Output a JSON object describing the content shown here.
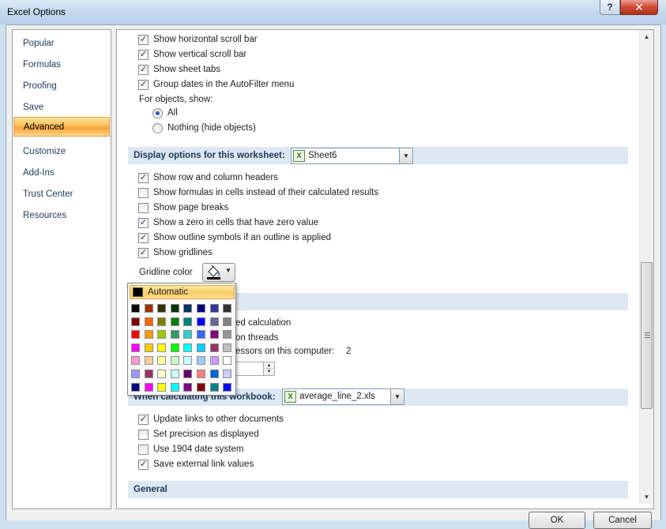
{
  "window": {
    "title": "Excel Options",
    "help_label": "?",
    "close_label": "✕"
  },
  "nav": {
    "items": [
      {
        "label": "Popular"
      },
      {
        "label": "Formulas"
      },
      {
        "label": "Proofing"
      },
      {
        "label": "Save"
      },
      {
        "label": "Advanced",
        "active": true
      },
      {
        "label": "Customize"
      },
      {
        "label": "Add-Ins"
      },
      {
        "label": "Trust Center"
      },
      {
        "label": "Resources"
      }
    ]
  },
  "window_options": {
    "horizontal_scroll": {
      "label": "Show horizontal scroll bar",
      "checked": true
    },
    "vertical_scroll": {
      "label": "Show vertical scroll bar",
      "checked": true
    },
    "sheet_tabs": {
      "label": "Show sheet tabs",
      "checked": true
    },
    "group_dates": {
      "label": "Group dates in the AutoFilter menu",
      "checked": true
    },
    "objects_label": "For objects, show:",
    "objects_all": {
      "label": "All",
      "selected": true
    },
    "objects_nothing": {
      "label": "Nothing (hide objects)",
      "selected": false
    }
  },
  "worksheet_section": {
    "title": "Display options for this worksheet:",
    "sheet": "Sheet6",
    "row_col_headers": {
      "label": "Show row and column headers",
      "checked": true
    },
    "formulas": {
      "label": "Show formulas in cells instead of their calculated results",
      "checked": false
    },
    "page_breaks": {
      "label": "Show page breaks",
      "checked": false
    },
    "zero": {
      "label": "Show a zero in cells that have zero value",
      "checked": true
    },
    "outline": {
      "label": "Show outline symbols if an outline is applied",
      "checked": true
    },
    "gridlines": {
      "label": "Show gridlines",
      "checked": true
    },
    "gridline_color_label": "Gridline color"
  },
  "formulas_section": {
    "enable_multithread": "ed calculation",
    "use_all_threads": "on threads",
    "processors_prefix": "essors on this computer:",
    "processors_count": "2"
  },
  "workbook_section": {
    "title": "When calculating this workbook:",
    "workbook": "average_line_2.xls",
    "update_links": {
      "label": "Update links to other documents",
      "checked": true
    },
    "precision": {
      "label": "Set precision as displayed",
      "checked": false
    },
    "date_1904": {
      "label": "Use 1904 date system",
      "checked": false
    },
    "external_links": {
      "label": "Save external link values",
      "checked": true
    }
  },
  "general_section": {
    "title": "General"
  },
  "palette": {
    "automatic_label": "Automatic",
    "colors": [
      [
        "#000000",
        "#993300",
        "#333300",
        "#003300",
        "#003366",
        "#000080",
        "#333399",
        "#333333"
      ],
      [
        "#800000",
        "#FF6600",
        "#808000",
        "#008000",
        "#008080",
        "#0000FF",
        "#666699",
        "#808080"
      ],
      [
        "#FF0000",
        "#FF9900",
        "#99CC00",
        "#339966",
        "#33CCCC",
        "#3366FF",
        "#800080",
        "#969696"
      ],
      [
        "#FF00FF",
        "#FFCC00",
        "#FFFF00",
        "#00FF00",
        "#00FFFF",
        "#00CCFF",
        "#993366",
        "#C0C0C0"
      ],
      [
        "#FF99CC",
        "#FFCC99",
        "#FFFF99",
        "#CCFFCC",
        "#CCFFFF",
        "#99CCFF",
        "#CC99FF",
        "#FFFFFF"
      ],
      [
        "#9999FF",
        "#993366",
        "#FFFFCC",
        "#CCFFFF",
        "#660066",
        "#FF8080",
        "#0066CC",
        "#CCCCFF"
      ],
      [
        "#000080",
        "#FF00FF",
        "#FFFF00",
        "#00FFFF",
        "#800080",
        "#800000",
        "#008080",
        "#0000FF"
      ]
    ]
  },
  "buttons": {
    "ok": "OK",
    "cancel": "Cancel"
  }
}
